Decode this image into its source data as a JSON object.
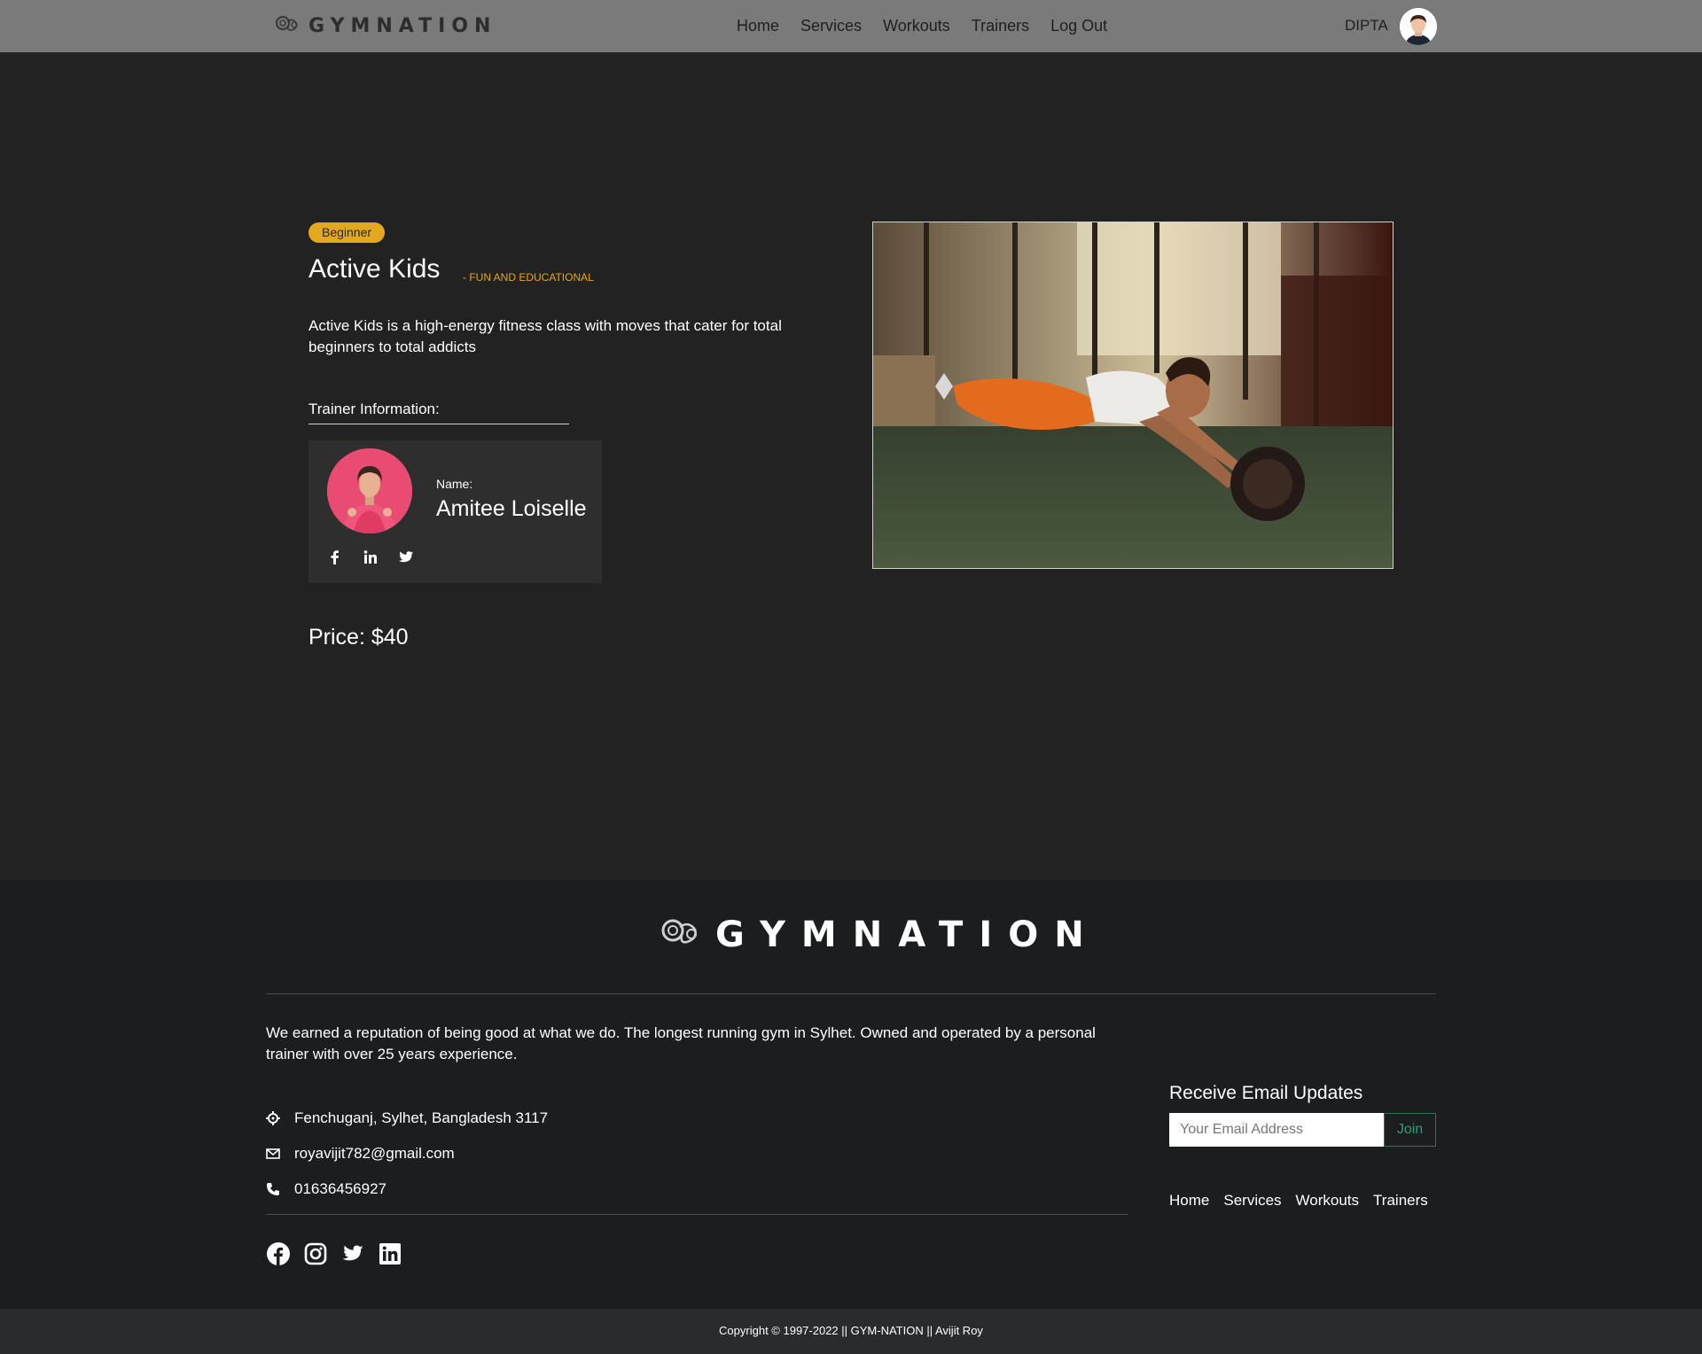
{
  "colors": {
    "accent": "#e3a81e",
    "navbar": "#7a7a7a",
    "background": "#222222",
    "footer": "#1b1d1e",
    "join": "#2aa172"
  },
  "navbar": {
    "logo_text": "GYMNATION",
    "links": [
      "Home",
      "Services",
      "Workouts",
      "Trainers",
      "Log Out"
    ],
    "user_name": "DIPTA"
  },
  "class": {
    "level": "Beginner",
    "title": "Active Kids",
    "tagline": "- FUN AND EDUCATIONAL",
    "description": "Active Kids is a high-energy fitness class with moves that cater for total beginners to total addicts",
    "trainer_heading": "Trainer Information:",
    "trainer": {
      "name_label": "Name:",
      "name": "Amitee Loiselle",
      "social_icons": [
        "facebook-icon",
        "linkedin-icon",
        "twitter-icon"
      ]
    },
    "price": "Price: $40"
  },
  "footer": {
    "logo_text": "GYMNATION",
    "about": "We earned a reputation of being good at what we do. The longest running gym in Sylhet. Owned and operated by a personal trainer with over 25 years experience.",
    "address": "Fenchuganj, Sylhet, Bangladesh 3117",
    "email": "royavijit782@gmail.com",
    "phone": "01636456927",
    "social_icons": [
      "facebook-icon",
      "instagram-icon",
      "twitter-icon",
      "linkedin-icon"
    ],
    "email_heading": "Receive Email Updates",
    "email_placeholder": "Your Email Address",
    "join_label": "Join",
    "links": [
      "Home",
      "Services",
      "Workouts",
      "Trainers"
    ],
    "copyright": "Copyright © 1997-2022 || GYM-NATION || Avijit Roy"
  }
}
